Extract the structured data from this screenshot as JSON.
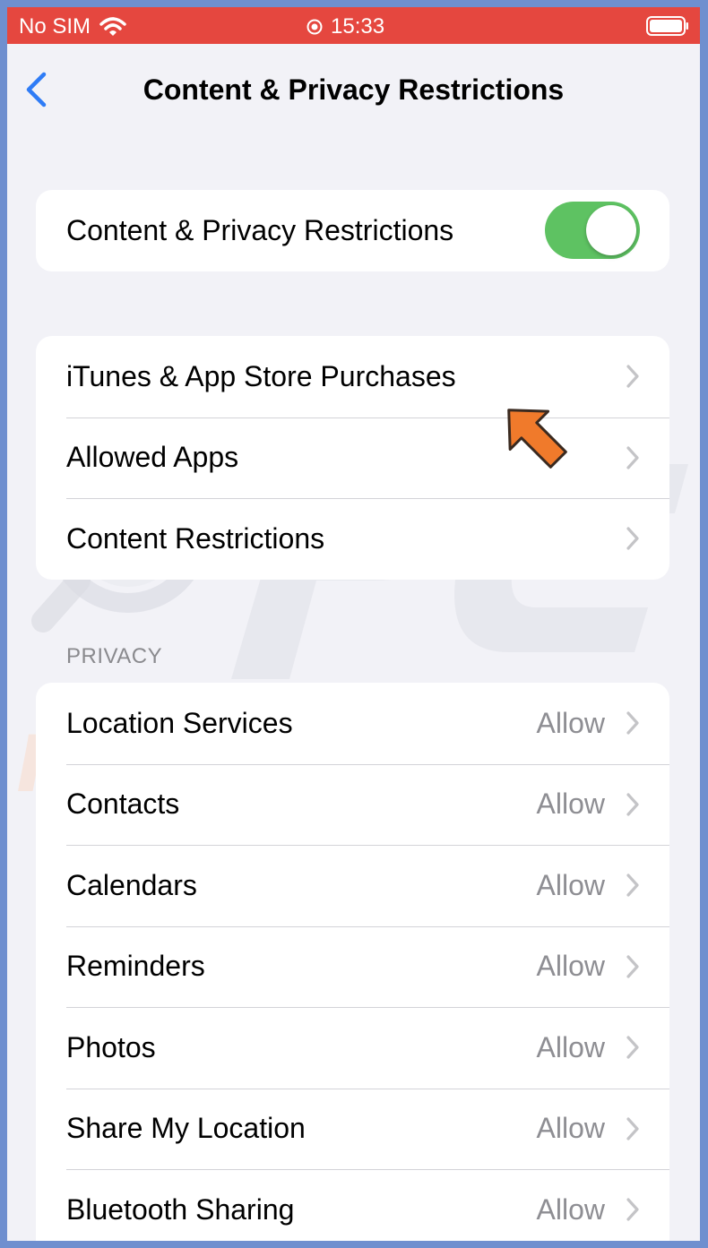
{
  "status_bar": {
    "carrier": "No SIM",
    "time": "15:33",
    "color": "#e5473f",
    "icons": [
      "wifi-icon",
      "clock-icon",
      "battery-icon"
    ]
  },
  "nav": {
    "title": "Content & Privacy Restrictions",
    "back_icon": "chevron-left-icon",
    "accent": "#2f7cf6"
  },
  "master_toggle": {
    "label": "Content & Privacy Restrictions",
    "on": true,
    "on_color": "#5ec262"
  },
  "menu_group": {
    "items": [
      {
        "label": "iTunes & App Store Purchases"
      },
      {
        "label": "Allowed Apps"
      },
      {
        "label": "Content Restrictions"
      }
    ]
  },
  "privacy": {
    "header": "PRIVACY",
    "items": [
      {
        "label": "Location Services",
        "value": "Allow"
      },
      {
        "label": "Contacts",
        "value": "Allow"
      },
      {
        "label": "Calendars",
        "value": "Allow"
      },
      {
        "label": "Reminders",
        "value": "Allow"
      },
      {
        "label": "Photos",
        "value": "Allow"
      },
      {
        "label": "Share My Location",
        "value": "Allow"
      },
      {
        "label": "Bluetooth Sharing",
        "value": "Allow"
      }
    ]
  },
  "annotation": {
    "arrow_icon": "pointer-arrow-icon",
    "arrow_color": "#f07a2b"
  },
  "watermark": {
    "text": "PC risk.com"
  }
}
